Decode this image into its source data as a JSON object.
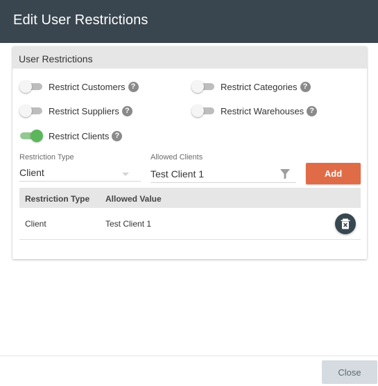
{
  "dialog": {
    "title": "Edit User Restrictions"
  },
  "card": {
    "title": "User Restrictions"
  },
  "toggles": [
    {
      "label": "Restrict Customers",
      "on": false
    },
    {
      "label": "Restrict Categories",
      "on": false
    },
    {
      "label": "Restrict Suppliers",
      "on": false
    },
    {
      "label": "Restrict Warehouses",
      "on": false
    },
    {
      "label": "Restrict Clients",
      "on": true
    }
  ],
  "help_glyph": "?",
  "form": {
    "restriction_type_label": "Restriction Type",
    "restriction_type_value": "Client",
    "allowed_label": "Allowed Clients",
    "allowed_value": "Test Client 1",
    "add_label": "Add"
  },
  "table": {
    "headers": [
      "Restriction Type",
      "Allowed Value"
    ],
    "rows": [
      {
        "type": "Client",
        "value": "Test Client 1"
      }
    ]
  },
  "footer": {
    "close_label": "Close"
  },
  "colors": {
    "header_bg": "#3a464f",
    "accent": "#e06c47",
    "toggle_on": "#5cb65b",
    "delete_bg": "#37474f"
  },
  "icons": [
    "help-icon",
    "chevron-down-icon",
    "filter-icon",
    "delete-icon"
  ]
}
